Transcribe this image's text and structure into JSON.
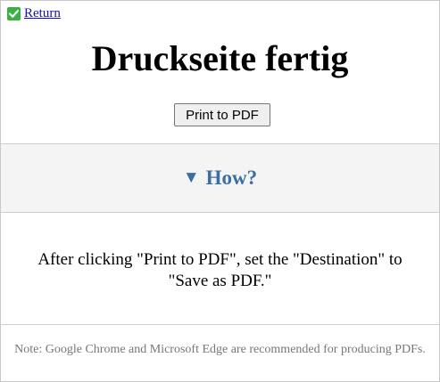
{
  "header": {
    "return_label": " Return",
    "return_icon": "checkmark-icon"
  },
  "main": {
    "title": "Druckseite fertig",
    "print_button_label": "Print to PDF"
  },
  "how": {
    "toggle_icon": "triangle-down-icon",
    "toggle_symbol": "▼",
    "label": "How?",
    "color": "#3a6ea5"
  },
  "instructions": {
    "text": "After clicking \"Print to PDF\", set the \"Destination\" to \"Save as PDF.\""
  },
  "footer": {
    "note": "Note: Google Chrome and Microsoft Edge are recommended for producing PDFs."
  },
  "colors": {
    "check_green": "#3cb043",
    "link": "#1a0dab",
    "section_bg": "#f4f4f4"
  }
}
